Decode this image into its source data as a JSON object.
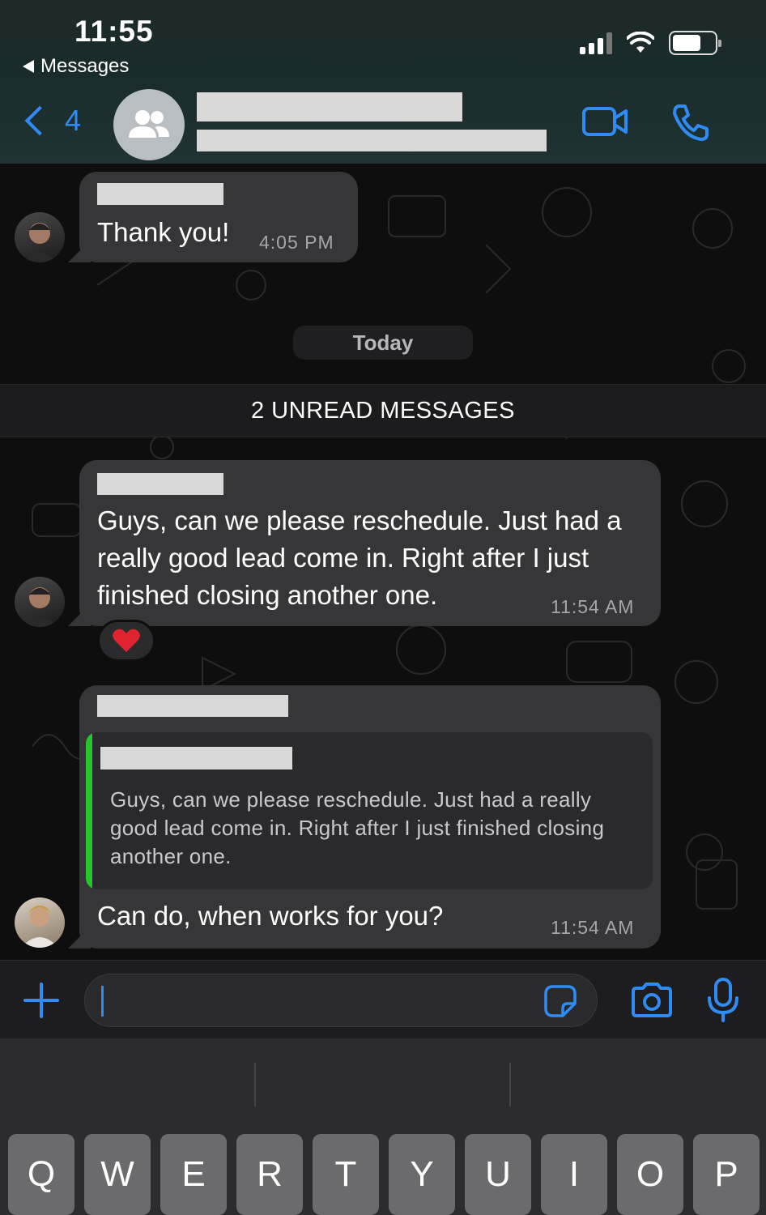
{
  "status_bar": {
    "time": "11:55",
    "back_app": "Messages"
  },
  "header": {
    "unread_count": "4"
  },
  "messages": [
    {
      "text": "Thank you!",
      "time": "4:05 PM"
    },
    {
      "text": "Guys, can we please reschedule. Just had a really good lead come in. Right after I just finished closing another one.",
      "time": "11:54 AM",
      "reaction": "❤️"
    },
    {
      "text": "Can do, when works for you?",
      "time": "11:54 AM",
      "quoted_text": "Guys, can we please reschedule. Just had a really good lead come in. Right after I just finished closing another one."
    }
  ],
  "chat": {
    "day_label": "Today",
    "unread_banner": "2 UNREAD MESSAGES"
  },
  "input": {
    "placeholder": ""
  },
  "keyboard": {
    "keys": [
      "Q",
      "W",
      "E",
      "R",
      "T",
      "Y",
      "U",
      "I",
      "O",
      "P"
    ]
  },
  "colors": {
    "accent": "#2f8cf5",
    "bubble": "#363638",
    "quote_bar": "#25c52b",
    "heart": "#e0242f"
  }
}
